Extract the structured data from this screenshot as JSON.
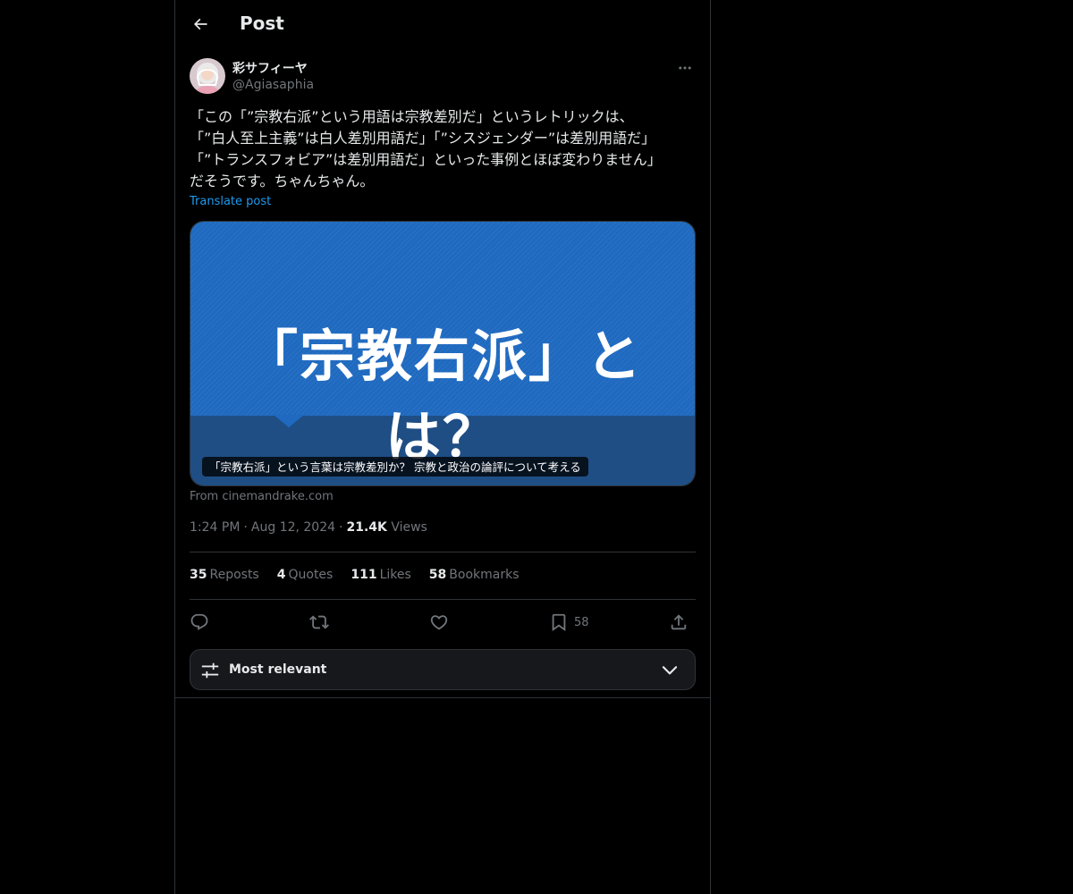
{
  "header": {
    "title": "Post"
  },
  "author": {
    "name": "彩サフィーヤ",
    "handle": "@Agiasaphia"
  },
  "post": {
    "lines": [
      "「この「”宗教右派”という用語は宗教差別だ」というレトリックは、",
      "「”白人至上主義”は白人差別用語だ」「”シスジェンダー”は差別用語だ」",
      "「”トランスフォビア”は差別用語だ」といった事例とほぼ変わりません」",
      "だそうです。ちゃんちゃん。"
    ],
    "translate_label": "Translate post"
  },
  "card": {
    "headline": "「宗教右派」とは？",
    "caption": "「宗教右派」という言葉は宗教差別か？ 宗教と政治の論評について考える",
    "source": "From cinemandrake.com"
  },
  "meta": {
    "time": "1:24 PM",
    "date": "Aug 12, 2024",
    "views_count": "21.4K",
    "views_label": "Views"
  },
  "stats": {
    "reposts": {
      "count": "35",
      "label": "Reposts"
    },
    "quotes": {
      "count": "4",
      "label": "Quotes"
    },
    "likes": {
      "count": "111",
      "label": "Likes"
    },
    "bookmarks": {
      "count": "58",
      "label": "Bookmarks"
    }
  },
  "actions": {
    "bookmark_count": "58"
  },
  "sort": {
    "label": "Most relevant"
  },
  "colors": {
    "accent": "#1d9bf0",
    "card_blue": "#1f6ac0",
    "muted": "#71767b"
  }
}
